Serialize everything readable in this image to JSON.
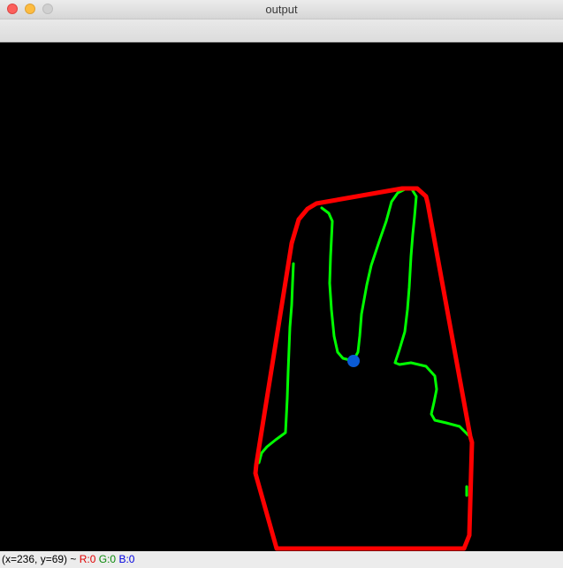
{
  "window": {
    "title": "output"
  },
  "canvas": {
    "background": "#000000",
    "hull_color": "#ff0000",
    "contour_color": "#00ff00",
    "point_color": "#0a5bd6"
  },
  "statusbar": {
    "coords": "(x=236, y=69) ~",
    "r": "R:0",
    "g": "G:0",
    "b": "B:0"
  }
}
